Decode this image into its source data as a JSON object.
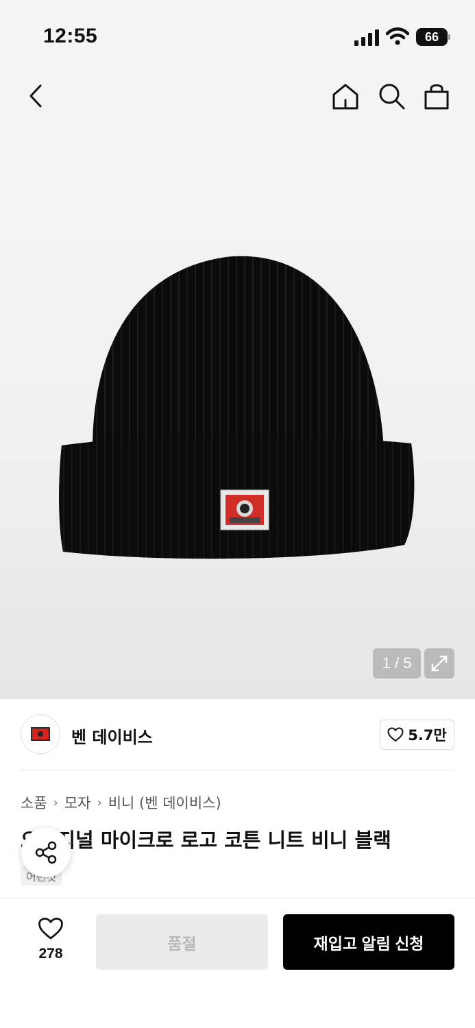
{
  "status_bar": {
    "time": "12:55",
    "battery": "66"
  },
  "header": {
    "back_icon": "chevron-left-icon",
    "home_icon": "home-icon",
    "search_icon": "search-icon",
    "bag_icon": "shopping-bag-icon"
  },
  "gallery": {
    "counter": "1 / 5",
    "expand_icon": "expand-icon"
  },
  "brand": {
    "name": "벤 데이비스",
    "like_count": "5.7만"
  },
  "breadcrumb": [
    "소품",
    "모자",
    "비니 (벤 데이비스)"
  ],
  "product": {
    "title": "오리지널 마이크로 로고 코튼 니트 비니 블랙",
    "tag": "어린것"
  },
  "bottom_bar": {
    "wish_count": "278",
    "soldout_label": "품절",
    "restock_label": "재입고 알림 신청"
  },
  "colors": {
    "primary_button": "#000000",
    "disabled_button": "#ebebeb",
    "brand_red": "#d4261e"
  }
}
